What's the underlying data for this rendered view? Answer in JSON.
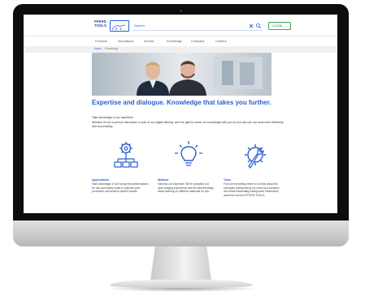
{
  "header": {
    "logo_text": "PFERD TOOLS",
    "search_placeholder": "Search",
    "login_label": "LOGIN",
    "login_arrow": "→"
  },
  "nav": {
    "items": [
      "Products",
      "Innovations",
      "Service",
      "Knowledge",
      "Company",
      "Careers"
    ]
  },
  "breadcrumb": [
    "Home",
    "Knowledge"
  ],
  "main": {
    "headline": "Expertise and dialogue. Knowledge that takes you further.",
    "intro_line1": "Take advantage of our expertise!",
    "intro_line2": "Whether it's an in-person discussion or part of our digital offering, we'd be glad to share our knowledge with you so you can use our tools more efficiently and successfully.",
    "features": [
      {
        "title": "Applications",
        "text": "Take advantage of our handy recommendations for use and safety notes to optimize your processes and achieve perfect results.",
        "icon": "gear-network-icon"
      },
      {
        "title": "Webinar",
        "text": "Harness our expertise! We've compiled our wide-ranging experience and the latest findings about working on different materials for you.",
        "icon": "lightbulb-icon"
      },
      {
        "title": "Tools",
        "text": "Find out everything there is to know about the principles underpinning our many tool solutions and obtain fascinating background information about the world of PFERD TOOLS.",
        "icon": "wrench-gear-icon"
      }
    ]
  },
  "colors": {
    "brand_blue": "#2b5fcf",
    "login_green": "#3aa65a",
    "monitor_bezel": "#0d0d0d"
  }
}
